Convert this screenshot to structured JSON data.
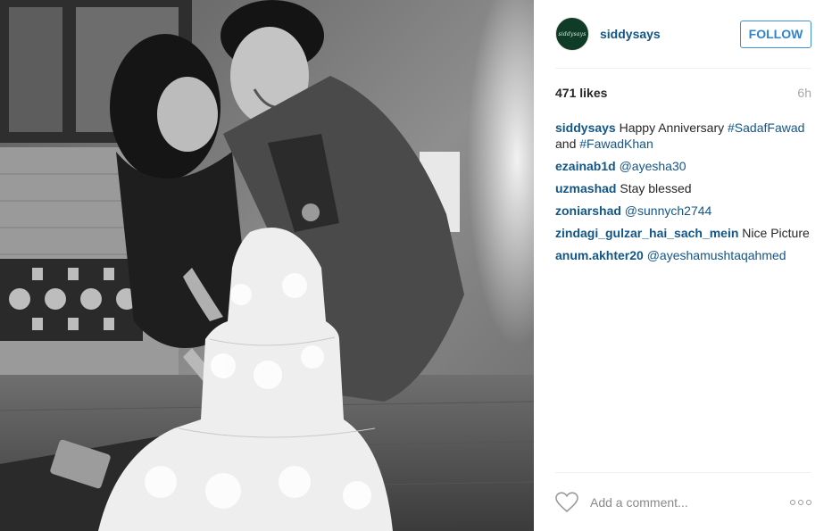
{
  "post": {
    "photo_icon": "photo-grayscale-couple-cutting-cake",
    "author": {
      "username": "siddysays",
      "avatar_text": "siddysays",
      "avatar_color": "#0f3b27"
    },
    "follow_label": "FOLLOW",
    "likes": "471 likes",
    "time": "6h",
    "caption": {
      "user": "siddysays",
      "text_before": "Happy Anniversary",
      "tag1": "#SadafFawad",
      "and": "and",
      "tag2": "#FawadKhan"
    },
    "comments": [
      {
        "user": "ezainab1d",
        "text": "",
        "mention": "@ayesha30"
      },
      {
        "user": "uzmashad",
        "text": "Stay blessed",
        "mention": ""
      },
      {
        "user": "zoniarshad",
        "text": "",
        "mention": "@sunnych2744"
      },
      {
        "user": "zindagi_gulzar_hai_sach_mein",
        "text": "Nice Picture",
        "mention": ""
      },
      {
        "user": "anum.akhter20",
        "text": "",
        "mention": "@ayeshamushtaqahmed"
      }
    ],
    "comment_placeholder": "Add a comment...",
    "like_icon": "heart-outline-icon",
    "more_icon": "more-options-icon"
  },
  "colors": {
    "link": "#125688",
    "follow": "#2f83cf"
  }
}
